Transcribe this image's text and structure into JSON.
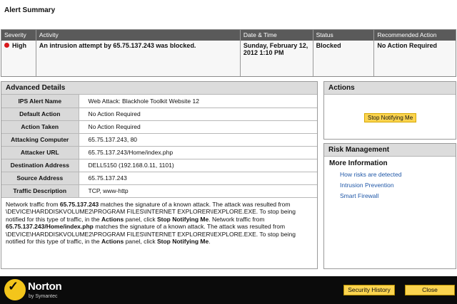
{
  "window": {
    "title": "Alert Summary"
  },
  "summary": {
    "headers": [
      "Severity",
      "Activity",
      "Date & Time",
      "Status",
      "Recommended Action"
    ],
    "row": {
      "severity": "High",
      "activity": "An intrusion attempt by 65.75.137.243 was blocked.",
      "datetime": "Sunday, February 12, 2012 1:10 PM",
      "status": "Blocked",
      "recommended_action": "No Action Required"
    },
    "severity_color": "#d8181c"
  },
  "advanced": {
    "title": "Advanced Details",
    "rows": [
      {
        "key": "IPS Alert Name",
        "value": "Web Attack: Blackhole Toolkit Website 12"
      },
      {
        "key": "Default Action",
        "value": "No Action Required"
      },
      {
        "key": "Action Taken",
        "value": "No Action Required"
      },
      {
        "key": "Attacking Computer",
        "value": "65.75.137.243, 80"
      },
      {
        "key": "Attacker URL",
        "value": "65.75.137.243/Home/index.php"
      },
      {
        "key": "Destination Address",
        "value": "DELL5150 (192.168.0.11, 1101)"
      },
      {
        "key": "Source Address",
        "value": "65.75.137.243"
      },
      {
        "key": "Traffic Description",
        "value": "TCP, www-http"
      }
    ],
    "description": {
      "p1_a": "Network traffic from ",
      "p1_b": "65.75.137.243",
      "p1_c": " matches the signature of a known attack. The attack was resulted from \\DEVICE\\HARDDISKVOLUME2\\PROGRAM FILES\\INTERNET EXPLORER\\IEXPLORE.EXE. To stop being notified for this type of traffic, in the ",
      "p1_d": "Actions",
      "p1_e": " panel, click ",
      "p1_f": "Stop Notifying Me",
      "p1_g": ". Network traffic from ",
      "p2_b": "65.75.137.243/Home/index.php",
      "p2_c": " matches the signature of a known attack. The attack was resulted from \\DEVICE\\HARDDISKVOLUME2\\PROGRAM FILES\\INTERNET EXPLORER\\IEXPLORE.EXE. To stop being notified for this type of traffic, in the ",
      "p2_d": "Actions",
      "p2_e": " panel, click ",
      "p2_f": "Stop Notifying Me",
      "p2_g": "."
    }
  },
  "actions": {
    "title": "Actions",
    "stop_button": "Stop Notifying Me"
  },
  "risk": {
    "title": "Risk Management",
    "more_info": "More Information",
    "links": [
      "How risks are detected",
      "Intrusion Prevention",
      "Smart Firewall"
    ]
  },
  "footer": {
    "brand": "Norton",
    "brand_sub": "by Symantec",
    "logo_icon": "checkmark-icon",
    "history_button": "Security History",
    "close_button": "Close"
  }
}
